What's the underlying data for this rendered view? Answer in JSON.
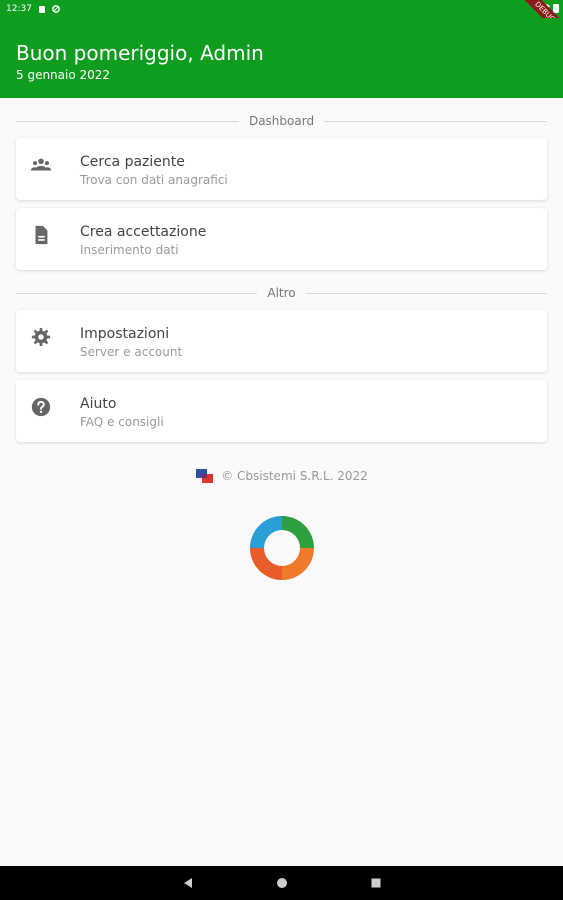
{
  "status_bar": {
    "time": "12:37",
    "debug_label": "DEBUG"
  },
  "header": {
    "greeting": "Buon pomeriggio, Admin",
    "date": "5 gennaio 2022"
  },
  "sections": {
    "dashboard": "Dashboard",
    "altro": "Altro"
  },
  "items": [
    {
      "title": "Cerca paziente",
      "subtitle": "Trova con dati anagrafici",
      "icon": "people-icon"
    },
    {
      "title": "Crea accettazione",
      "subtitle": "Inserimento dati",
      "icon": "document-icon"
    },
    {
      "title": "Impostazioni",
      "subtitle": "Server e account",
      "icon": "gear-icon"
    },
    {
      "title": "Aiuto",
      "subtitle": "FAQ e consigli",
      "icon": "help-icon"
    }
  ],
  "footer": {
    "copyright": "© Cbsistemi S.R.L. 2022"
  },
  "colors": {
    "primary": "#0f9d1f",
    "background": "#fafafa"
  }
}
